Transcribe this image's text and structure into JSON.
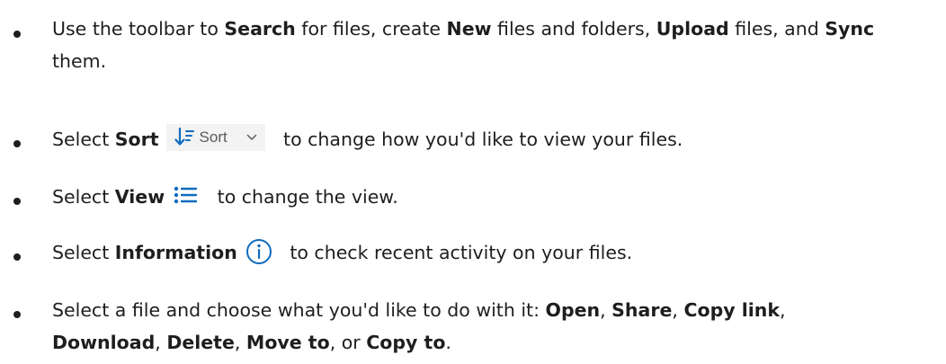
{
  "items": [
    {
      "parts": [
        {
          "text": "Use the toolbar to ",
          "bold": false
        },
        {
          "text": "Search",
          "bold": true
        },
        {
          "text": " for files, create ",
          "bold": false
        },
        {
          "text": "New",
          "bold": true
        },
        {
          "text": " files and folders, ",
          "bold": false
        },
        {
          "text": "Upload",
          "bold": true
        },
        {
          "text": " files, and ",
          "bold": false
        },
        {
          "text": "Sync",
          "bold": true
        },
        {
          "text": " them.",
          "bold": false
        }
      ]
    },
    {
      "pre": "Select ",
      "bold": "Sort",
      "post": " to change how you'd like to view your files.",
      "chip": {
        "label": "Sort",
        "icons": [
          "sort-arrow-icon",
          "chevron-down-icon"
        ],
        "color": "#0f6cbd"
      }
    },
    {
      "pre": "Select ",
      "bold": "View",
      "post": " to change the view.",
      "chip": {
        "icons": [
          "list-view-icon"
        ],
        "color": "#0f6cbd"
      }
    },
    {
      "pre": "Select ",
      "bold": "Information",
      "post": " to check recent activity on your files.",
      "chip": {
        "icons": [
          "info-icon"
        ],
        "color": "#0f6cbd"
      }
    },
    {
      "parts": [
        {
          "text": "Select a file and choose what you'd like to do with it: ",
          "bold": false
        },
        {
          "text": "Open",
          "bold": true
        },
        {
          "text": ", ",
          "bold": false
        },
        {
          "text": "Share",
          "bold": true
        },
        {
          "text": ", ",
          "bold": false
        },
        {
          "text": "Copy link",
          "bold": true
        },
        {
          "text": ", ",
          "bold": false
        },
        {
          "text": "Download",
          "bold": true
        },
        {
          "text": ", ",
          "bold": false
        },
        {
          "text": "Delete",
          "bold": true
        },
        {
          "text": ", ",
          "bold": false
        },
        {
          "text": "Move to",
          "bold": true
        },
        {
          "text": ", or ",
          "bold": false
        },
        {
          "text": "Copy to",
          "bold": true
        },
        {
          "text": ".",
          "bold": false
        }
      ]
    }
  ]
}
